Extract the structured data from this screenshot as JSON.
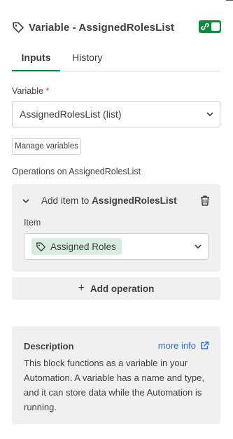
{
  "header": {
    "title": "Variable - AssignedRolesList",
    "icon": "tag-icon",
    "toggle_color": "#0b8a3e"
  },
  "tabs": [
    {
      "label": "Inputs",
      "active": true
    },
    {
      "label": "History",
      "active": false
    }
  ],
  "variable_field": {
    "label": "Variable",
    "required_mark": "*",
    "value": "AssignedRolesList (list)"
  },
  "manage_button": {
    "label": "Manage variables"
  },
  "operations": {
    "heading": "Operations on AssignedRolesList",
    "items": [
      {
        "title_prefix": "Add item to",
        "title_target": "AssignedRolesList",
        "field_label": "Item",
        "pill_label": "Assigned Roles"
      }
    ],
    "add_label": "Add operation"
  },
  "description": {
    "title": "Description",
    "more_info": "more info",
    "text": "This block functions as a variable in your Automation. A variable has a name and type, and it can store data while the Automation is running."
  },
  "colors": {
    "accent": "#0b8a3e",
    "link": "#2a72c9",
    "required": "#d93c3c",
    "pill_bg": "#d8ece0"
  }
}
